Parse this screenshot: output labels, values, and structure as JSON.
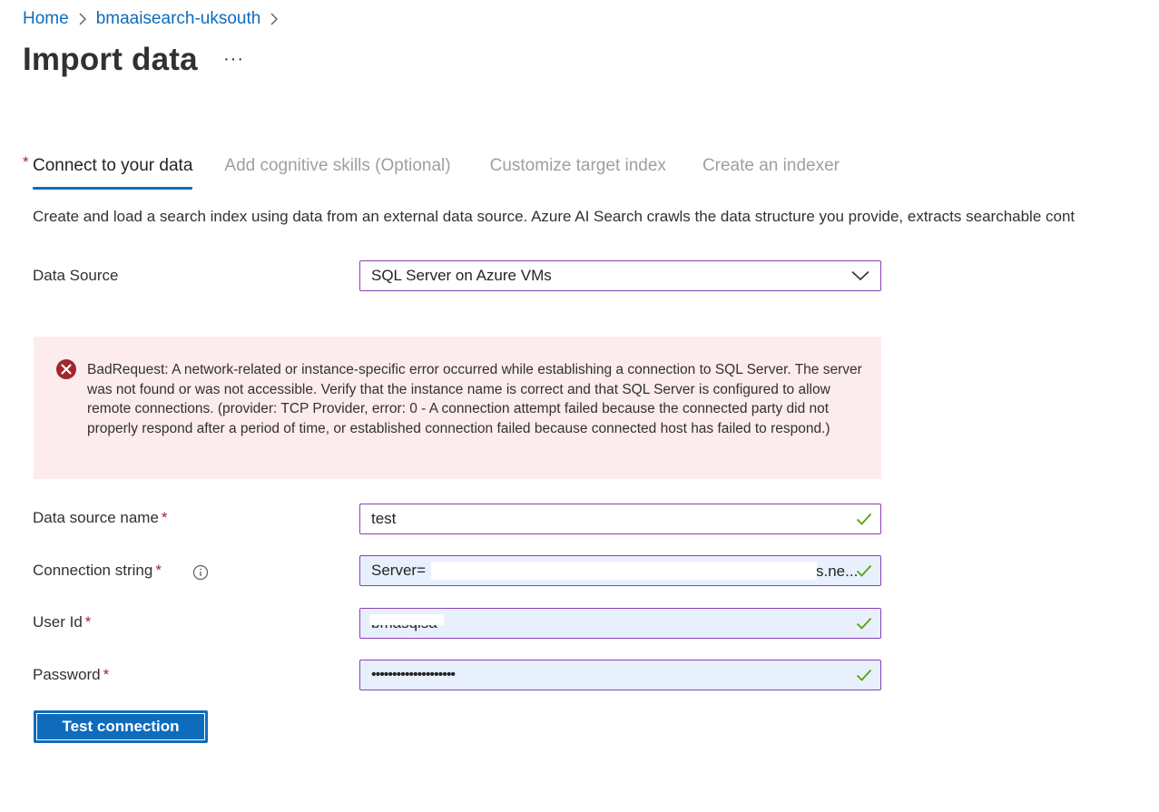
{
  "breadcrumb": {
    "items": [
      "Home",
      "bmaaisearch-uksouth"
    ]
  },
  "page": {
    "title": "Import data",
    "more_label": "···"
  },
  "tabs": [
    {
      "label": "Connect to your data",
      "active": true,
      "required": true
    },
    {
      "label": "Add cognitive skills (Optional)",
      "active": false
    },
    {
      "label": "Customize target index",
      "active": false
    },
    {
      "label": "Create an indexer",
      "active": false
    }
  ],
  "description": "Create and load a search index using data from an external data source. Azure AI Search crawls the data structure you provide, extracts searchable cont",
  "form": {
    "data_source": {
      "label": "Data Source",
      "value": "SQL Server on Azure VMs"
    },
    "error": {
      "message": "BadRequest: A network-related or instance-specific error occurred while establishing a connection to SQL Server. The server was not found or was not accessible. Verify that the instance name is correct and that SQL Server is configured to allow remote connections. (provider: TCP Provider, error: 0 - A connection attempt failed because the connected party did not properly respond after a period of time, or established connection failed because connected host has failed to respond.)"
    },
    "data_source_name": {
      "label": "Data source name",
      "value": "test"
    },
    "connection_string": {
      "label": "Connection string",
      "value": "Server=",
      "value_suffix": "s.ne..."
    },
    "user_id": {
      "label": "User Id",
      "value": "bmasqlsa"
    },
    "password": {
      "label": "Password",
      "value": "••••••••••••••••••••"
    },
    "required_marker": "*"
  },
  "actions": {
    "test_connection_label": "Test connection"
  },
  "colors": {
    "accent": "#0f6cbd",
    "field_border": "#8a3fb4",
    "error_bg": "#fdeced",
    "error_icon": "#a4262c",
    "success_check": "#57a300",
    "required": "#a4262c"
  }
}
